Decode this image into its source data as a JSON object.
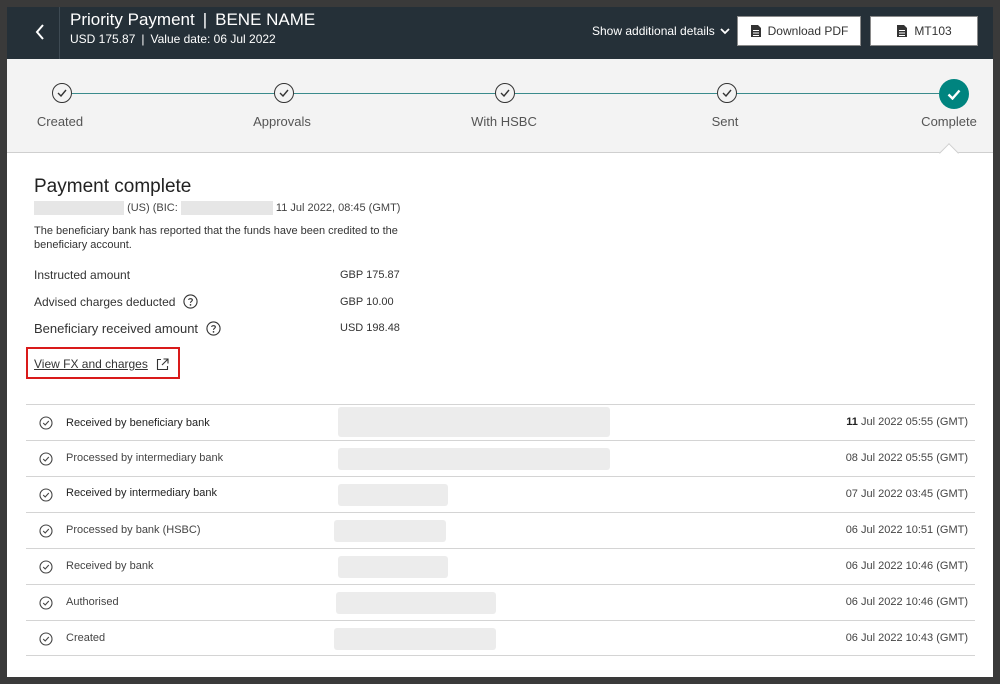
{
  "header": {
    "title": "Priority Payment",
    "bene_name": "BENE NAME",
    "title_sep": "|",
    "amount": "USD 175.87",
    "sub_sep": "|",
    "value_date": "Value date: 06 Jul 2022",
    "show_details_label": "Show additional details",
    "download_pdf_label": "Download PDF",
    "mt103_label": "MT103"
  },
  "stepper": {
    "steps": [
      {
        "label": "Created"
      },
      {
        "label": "Approvals"
      },
      {
        "label": "With HSBC"
      },
      {
        "label": "Sent"
      },
      {
        "label": "Complete"
      }
    ]
  },
  "status": {
    "title": "Payment complete",
    "bank_country": "(US) (BIC:",
    "timestamp": "11 Jul 2022, 08:45 (GMT)",
    "description": "The beneficiary bank has reported that the funds have been credited to the beneficiary account."
  },
  "amounts": {
    "instructed_label": "Instructed amount",
    "instructed_value": "GBP 175.87",
    "charges_label": "Advised charges deducted",
    "charges_value": "GBP  10.00",
    "received_label": "Beneficiary received amount",
    "received_value": "USD 198.48"
  },
  "fx_link_label": "View FX and charges",
  "events": [
    {
      "label": "Received by beneficiary bank",
      "time_day": "11",
      "time_rest": " Jul 2022 05:55 (GMT)"
    },
    {
      "label": "Processed by intermediary bank",
      "time_day": "08",
      "time_rest": " Jul 2022 05:55 (GMT)"
    },
    {
      "label": "Received by intermediary bank",
      "time_day": "07",
      "time_rest": " Jul 2022 03:45 (GMT)"
    },
    {
      "label": "Processed by bank (HSBC)",
      "time_day": "06",
      "time_rest": " Jul 2022 10:51 (GMT)"
    },
    {
      "label": "Received by bank",
      "time_day": "06",
      "time_rest": " Jul 2022 10:46 (GMT)"
    },
    {
      "label": "Authorised",
      "time_day": "06",
      "time_rest": " Jul 2022 10:46 (GMT)"
    },
    {
      "label": "Created",
      "time_day": "06",
      "time_rest": " Jul 2022 10:43 (GMT)"
    }
  ],
  "colors": {
    "header_bg": "#253038",
    "accent_teal": "#00847f",
    "highlight_red": "#d91a1a"
  }
}
